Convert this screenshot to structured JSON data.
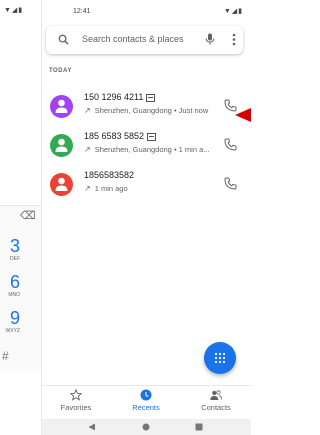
{
  "status": {
    "time": "12:41"
  },
  "search": {
    "placeholder": "Search contacts & places"
  },
  "section_label": "TODAY",
  "calls": [
    {
      "number": "150 1296 4211",
      "location": "Shenzhen, Guangdong",
      "time": "Just now",
      "color": "#a142f4"
    },
    {
      "number": "185 6583 5852",
      "location": "Shenzhen, Guangdong",
      "time": "1 min a...",
      "color": "#34a853"
    },
    {
      "number": "1856583582",
      "location": "",
      "time": "1 min ago",
      "color": "#ea4335"
    }
  ],
  "tabs": {
    "favorites": "Favorites",
    "recents": "Recents",
    "contacts": "Contacts"
  },
  "peek_keys": [
    {
      "digit": "3",
      "letters": "DEF"
    },
    {
      "digit": "6",
      "letters": "MNO"
    },
    {
      "digit": "9",
      "letters": "WXYZ"
    }
  ],
  "peek_hash": "#",
  "accent": "#1a73e8"
}
